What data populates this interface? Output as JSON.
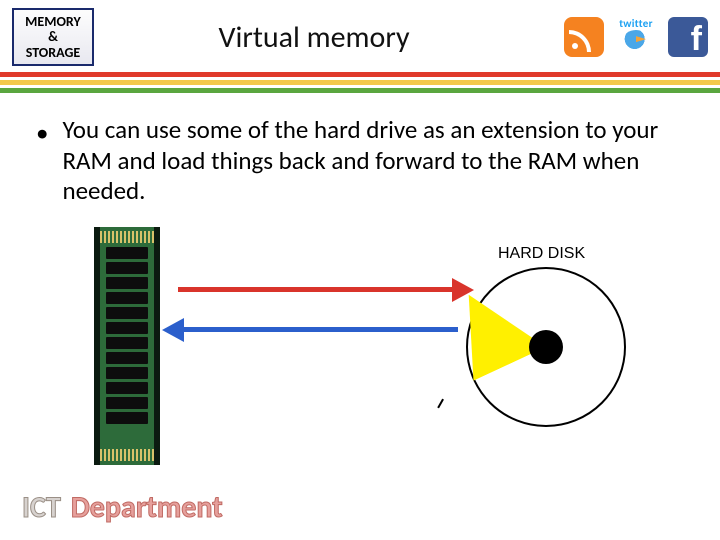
{
  "header": {
    "badge_line1": "MEMORY",
    "badge_line2": "&",
    "badge_line3": "STORAGE",
    "title": "Virtual memory",
    "social": {
      "rss": "rss-icon",
      "twitter_text": "twitter",
      "twitter": "twitter-bird-icon",
      "facebook_glyph": "f"
    }
  },
  "bullet": {
    "marker": "•",
    "text": "You can use some of the hard drive as an extension to your RAM and load things back and forward to the RAM when needed."
  },
  "diagram": {
    "hard_disk_label": "HARD DISK"
  },
  "footer": {
    "ict": "ICT",
    "department": "Department"
  }
}
